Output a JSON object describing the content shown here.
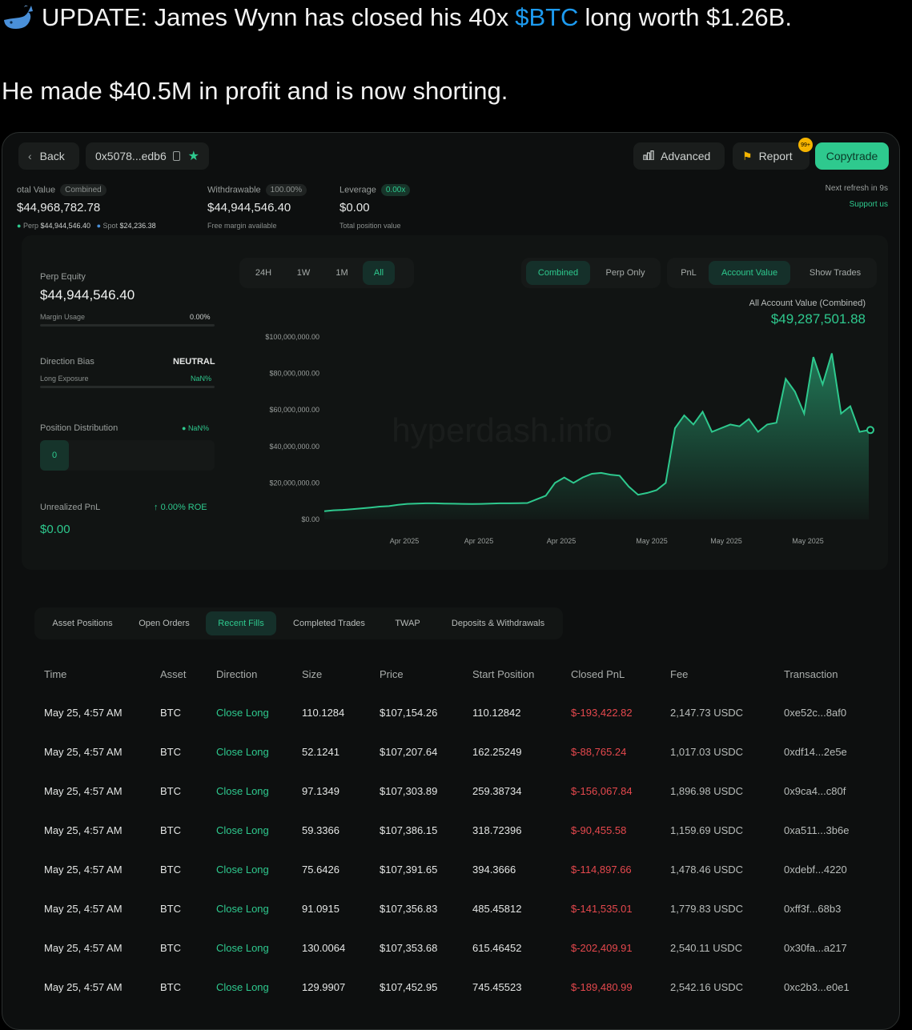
{
  "tweet": {
    "prefix": "UPDATE: James Wynn has closed his 40x",
    "cashtag": "$BTC",
    "suffix": "long worth $1.26B.",
    "line2": "He made $40.5M in profit and is now shorting."
  },
  "header": {
    "back_label": "Back",
    "address": "0x5078...edb6",
    "advanced_label": "Advanced",
    "report_label": "Report",
    "report_badge": "99+",
    "copytrade_label": "Copytrade",
    "refresh_text": "Next refresh in 9s",
    "support_text": "Support us"
  },
  "stats": {
    "total_label": "otal Value",
    "total_tag": "Combined",
    "total_value": "$44,968,782.78",
    "perp_label": "Perp",
    "perp_value": "$44,944,546.40",
    "spot_label": "Spot",
    "spot_value": "$24,236.38",
    "withdrawable_label": "Withdrawable",
    "withdrawable_tag": "100.00%",
    "withdrawable_value": "$44,944,546.40",
    "withdrawable_sub": "Free margin available",
    "leverage_label": "Leverage",
    "leverage_tag": "0.00x",
    "leverage_value": "$0.00",
    "leverage_sub": "Total position value"
  },
  "left_panel": {
    "perp_equity_label": "Perp Equity",
    "perp_equity_value": "$44,944,546.40",
    "margin_usage_label": "Margin Usage",
    "margin_usage_value": "0.00%",
    "direction_bias_label": "Direction Bias",
    "direction_bias_value": "NEUTRAL",
    "long_exposure_label": "Long Exposure",
    "long_exposure_value": "NaN%",
    "position_dist_label": "Position Distribution",
    "position_dist_value": "NaN%",
    "position_box_value": "0",
    "unrealized_label": "Unrealized PnL",
    "unrealized_roe": "0.00% ROE",
    "unrealized_value": "$0.00"
  },
  "chart_controls": {
    "ranges": [
      "24H",
      "1W",
      "1M",
      "All"
    ],
    "active_range": "All",
    "views": [
      "Combined",
      "Perp Only"
    ],
    "active_view": "Combined",
    "metrics": [
      "PnL",
      "Account Value",
      "Show Trades"
    ],
    "active_metric": "Account Value",
    "summary_label": "All Account Value (Combined)",
    "summary_value": "$49,287,501.88",
    "watermark": "hyperdash.info"
  },
  "chart_data": {
    "type": "area",
    "ylim": [
      0,
      100000000
    ],
    "y_ticks": [
      "$100,000,000.00",
      "$80,000,000.00",
      "$60,000,000.00",
      "$40,000,000.00",
      "$20,000,000.00",
      "$0.00"
    ],
    "x_ticks": [
      "Apr 2025",
      "Apr 2025",
      "Apr 2025",
      "May 2025",
      "May 2025",
      "May 2025"
    ],
    "series": [
      {
        "values": [
          4500000,
          5000000,
          5200000,
          5600000,
          6000000,
          6500000,
          7000000,
          7300000,
          8000000,
          8500000,
          8700000,
          8800000,
          8800000,
          8700000,
          8600000,
          8500000,
          8400000,
          8500000,
          8700000,
          8800000,
          8800000,
          8900000,
          9000000,
          11000000,
          13000000,
          20000000,
          23000000,
          20000000,
          23000000,
          25000000,
          25500000,
          24500000,
          24000000,
          18000000,
          13500000,
          14500000,
          16000000,
          20000000,
          50000000,
          57000000,
          52000000,
          59000000,
          48000000,
          50000000,
          52000000,
          51000000,
          55000000,
          48000000,
          52000000,
          53000000,
          77000000,
          70000000,
          58000000,
          89000000,
          74000000,
          91000000,
          58000000,
          62000000,
          48000000,
          49000000
        ]
      }
    ]
  },
  "tabs": [
    "Asset Positions",
    "Open Orders",
    "Recent Fills",
    "Completed Trades",
    "TWAP",
    "Deposits & Withdrawals"
  ],
  "active_tab": "Recent Fills",
  "table": {
    "headers": [
      "Time",
      "Asset",
      "Direction",
      "Size",
      "Price",
      "Start Position",
      "Closed PnL",
      "Fee",
      "Transaction"
    ],
    "rows": [
      [
        "May 25, 4:57 AM",
        "BTC",
        "Close Long",
        "110.1284",
        "$107,154.26",
        "110.12842",
        "$-193,422.82",
        "2,147.73 USDC",
        "0xe52c...8af0"
      ],
      [
        "May 25, 4:57 AM",
        "BTC",
        "Close Long",
        "52.1241",
        "$107,207.64",
        "162.25249",
        "$-88,765.24",
        "1,017.03 USDC",
        "0xdf14...2e5e"
      ],
      [
        "May 25, 4:57 AM",
        "BTC",
        "Close Long",
        "97.1349",
        "$107,303.89",
        "259.38734",
        "$-156,067.84",
        "1,896.98 USDC",
        "0x9ca4...c80f"
      ],
      [
        "May 25, 4:57 AM",
        "BTC",
        "Close Long",
        "59.3366",
        "$107,386.15",
        "318.72396",
        "$-90,455.58",
        "1,159.69 USDC",
        "0xa511...3b6e"
      ],
      [
        "May 25, 4:57 AM",
        "BTC",
        "Close Long",
        "75.6426",
        "$107,391.65",
        "394.3666",
        "$-114,897.66",
        "1,478.46 USDC",
        "0xdebf...4220"
      ],
      [
        "May 25, 4:57 AM",
        "BTC",
        "Close Long",
        "91.0915",
        "$107,356.83",
        "485.45812",
        "$-141,535.01",
        "1,779.83 USDC",
        "0xff3f...68b3"
      ],
      [
        "May 25, 4:57 AM",
        "BTC",
        "Close Long",
        "130.0064",
        "$107,353.68",
        "615.46452",
        "$-202,409.91",
        "2,540.11 USDC",
        "0x30fa...a217"
      ],
      [
        "May 25, 4:57 AM",
        "BTC",
        "Close Long",
        "129.9907",
        "$107,452.95",
        "745.45523",
        "$-189,480.99",
        "2,542.16 USDC",
        "0xc2b3...e0e1"
      ]
    ]
  },
  "colors": {
    "accent": "#2ec98e",
    "negative": "#e5484d",
    "link": "#1d9bf0"
  }
}
